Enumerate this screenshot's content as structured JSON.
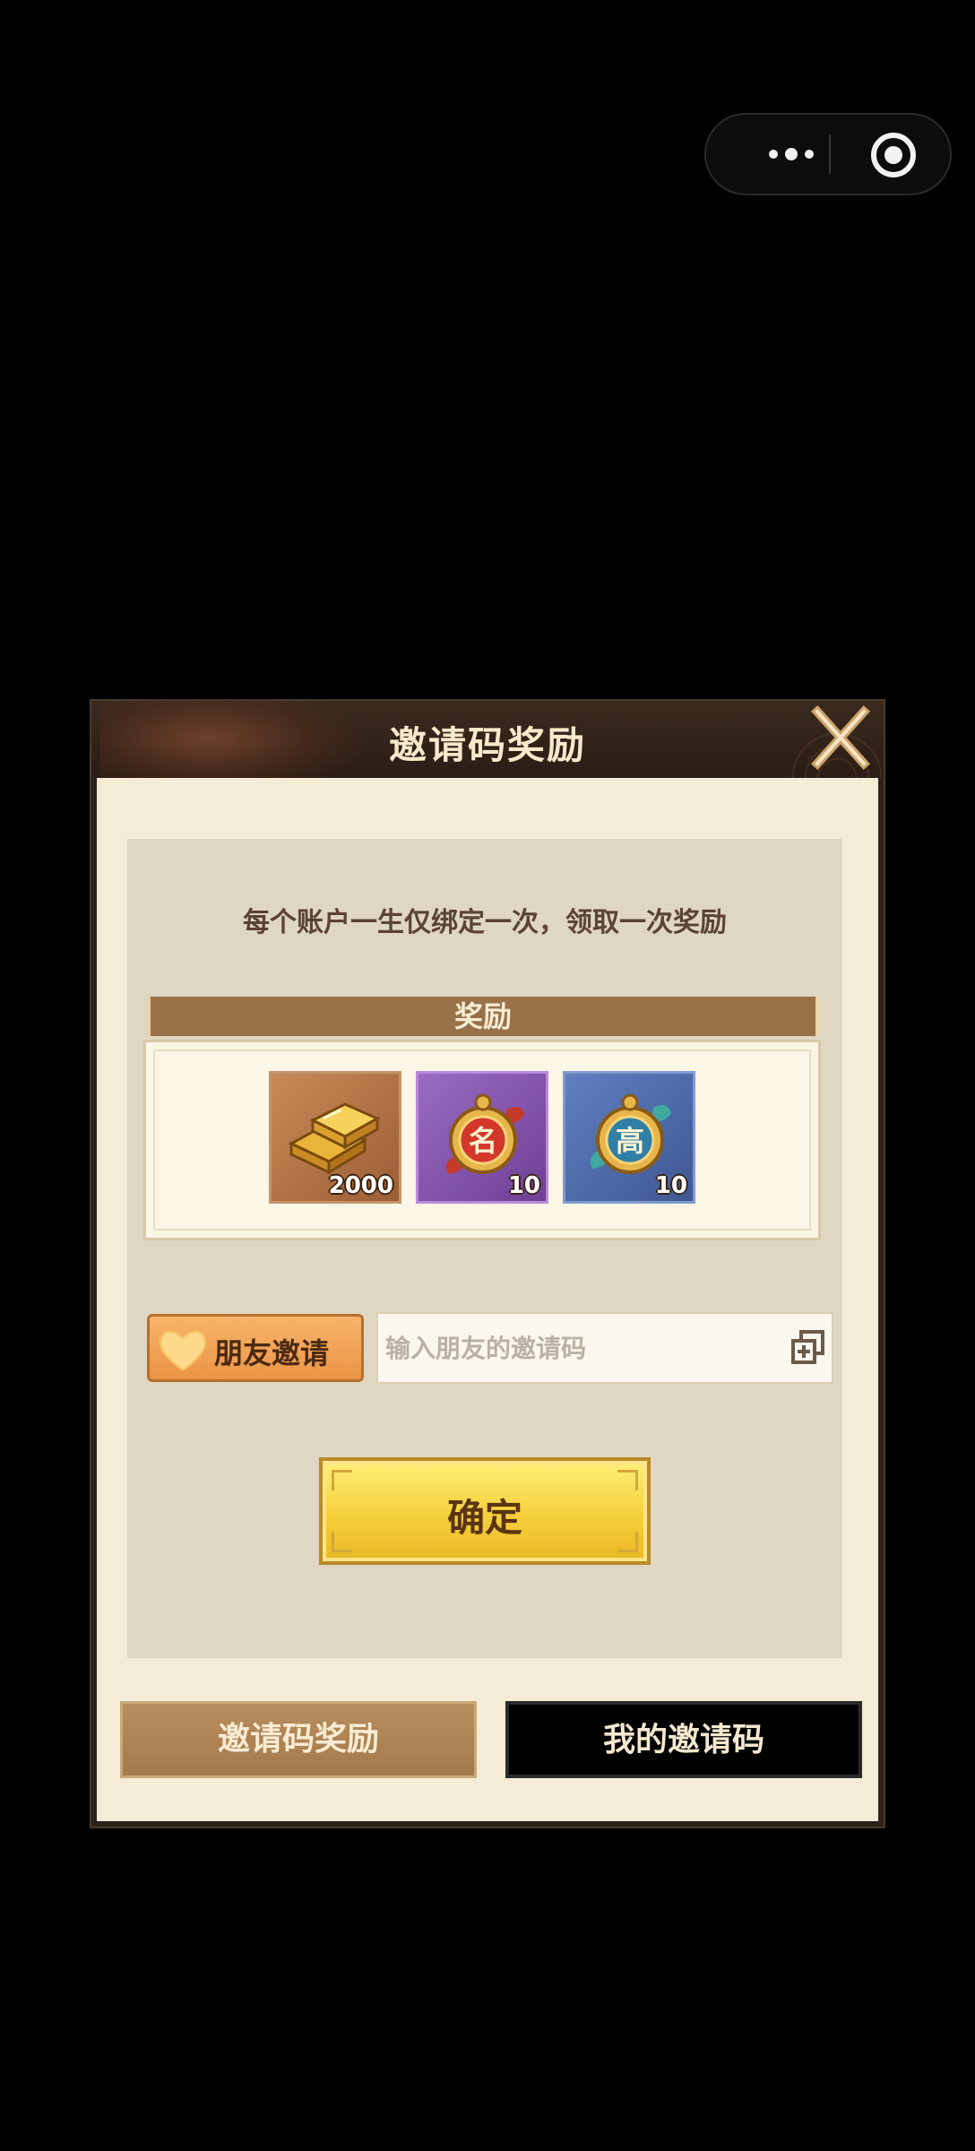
{
  "capsule": {
    "more_icon": "more-dots-icon",
    "close_icon": "target-circle-icon"
  },
  "dialog": {
    "title": "邀请码奖励",
    "close_icon": "crossed-swords-close-icon",
    "notice": "每个账户一生仅绑定一次，领取一次奖励",
    "reward_header": "奖励",
    "rewards": [
      {
        "icon": "gold-bars-icon",
        "count": "2000",
        "frame_color": "#a8683d"
      },
      {
        "icon": "famous-medal-icon",
        "glyph": "名",
        "count": "10",
        "frame_color": "#7d4fa8"
      },
      {
        "icon": "advanced-medal-icon",
        "glyph": "高",
        "count": "10",
        "frame_color": "#4d67a6"
      }
    ],
    "friend_invite_label": "朋友邀请",
    "code_input": {
      "placeholder": "输入朋友的邀请码",
      "value": ""
    },
    "confirm_label": "确定",
    "tabs": [
      {
        "label": "邀请码奖励",
        "active": true
      },
      {
        "label": "我的邀请码",
        "active": false
      }
    ]
  }
}
